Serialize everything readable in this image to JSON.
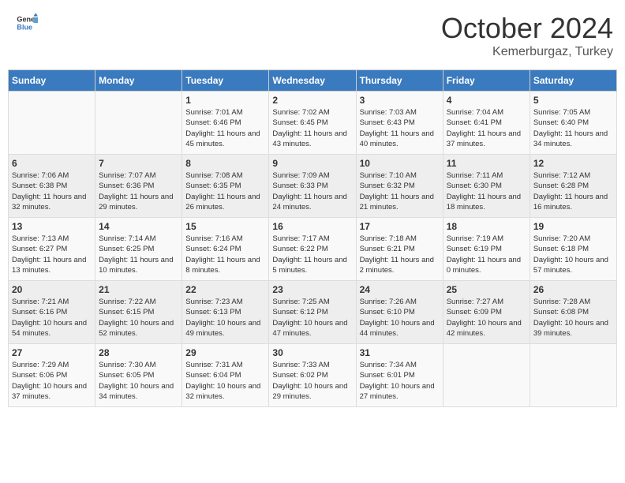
{
  "header": {
    "logo_general": "General",
    "logo_blue": "Blue",
    "month": "October 2024",
    "location": "Kemerburgaz, Turkey"
  },
  "days_of_week": [
    "Sunday",
    "Monday",
    "Tuesday",
    "Wednesday",
    "Thursday",
    "Friday",
    "Saturday"
  ],
  "weeks": [
    [
      {
        "day": "",
        "sunrise": "",
        "sunset": "",
        "daylight": ""
      },
      {
        "day": "",
        "sunrise": "",
        "sunset": "",
        "daylight": ""
      },
      {
        "day": "1",
        "sunrise": "Sunrise: 7:01 AM",
        "sunset": "Sunset: 6:46 PM",
        "daylight": "Daylight: 11 hours and 45 minutes."
      },
      {
        "day": "2",
        "sunrise": "Sunrise: 7:02 AM",
        "sunset": "Sunset: 6:45 PM",
        "daylight": "Daylight: 11 hours and 43 minutes."
      },
      {
        "day": "3",
        "sunrise": "Sunrise: 7:03 AM",
        "sunset": "Sunset: 6:43 PM",
        "daylight": "Daylight: 11 hours and 40 minutes."
      },
      {
        "day": "4",
        "sunrise": "Sunrise: 7:04 AM",
        "sunset": "Sunset: 6:41 PM",
        "daylight": "Daylight: 11 hours and 37 minutes."
      },
      {
        "day": "5",
        "sunrise": "Sunrise: 7:05 AM",
        "sunset": "Sunset: 6:40 PM",
        "daylight": "Daylight: 11 hours and 34 minutes."
      }
    ],
    [
      {
        "day": "6",
        "sunrise": "Sunrise: 7:06 AM",
        "sunset": "Sunset: 6:38 PM",
        "daylight": "Daylight: 11 hours and 32 minutes."
      },
      {
        "day": "7",
        "sunrise": "Sunrise: 7:07 AM",
        "sunset": "Sunset: 6:36 PM",
        "daylight": "Daylight: 11 hours and 29 minutes."
      },
      {
        "day": "8",
        "sunrise": "Sunrise: 7:08 AM",
        "sunset": "Sunset: 6:35 PM",
        "daylight": "Daylight: 11 hours and 26 minutes."
      },
      {
        "day": "9",
        "sunrise": "Sunrise: 7:09 AM",
        "sunset": "Sunset: 6:33 PM",
        "daylight": "Daylight: 11 hours and 24 minutes."
      },
      {
        "day": "10",
        "sunrise": "Sunrise: 7:10 AM",
        "sunset": "Sunset: 6:32 PM",
        "daylight": "Daylight: 11 hours and 21 minutes."
      },
      {
        "day": "11",
        "sunrise": "Sunrise: 7:11 AM",
        "sunset": "Sunset: 6:30 PM",
        "daylight": "Daylight: 11 hours and 18 minutes."
      },
      {
        "day": "12",
        "sunrise": "Sunrise: 7:12 AM",
        "sunset": "Sunset: 6:28 PM",
        "daylight": "Daylight: 11 hours and 16 minutes."
      }
    ],
    [
      {
        "day": "13",
        "sunrise": "Sunrise: 7:13 AM",
        "sunset": "Sunset: 6:27 PM",
        "daylight": "Daylight: 11 hours and 13 minutes."
      },
      {
        "day": "14",
        "sunrise": "Sunrise: 7:14 AM",
        "sunset": "Sunset: 6:25 PM",
        "daylight": "Daylight: 11 hours and 10 minutes."
      },
      {
        "day": "15",
        "sunrise": "Sunrise: 7:16 AM",
        "sunset": "Sunset: 6:24 PM",
        "daylight": "Daylight: 11 hours and 8 minutes."
      },
      {
        "day": "16",
        "sunrise": "Sunrise: 7:17 AM",
        "sunset": "Sunset: 6:22 PM",
        "daylight": "Daylight: 11 hours and 5 minutes."
      },
      {
        "day": "17",
        "sunrise": "Sunrise: 7:18 AM",
        "sunset": "Sunset: 6:21 PM",
        "daylight": "Daylight: 11 hours and 2 minutes."
      },
      {
        "day": "18",
        "sunrise": "Sunrise: 7:19 AM",
        "sunset": "Sunset: 6:19 PM",
        "daylight": "Daylight: 11 hours and 0 minutes."
      },
      {
        "day": "19",
        "sunrise": "Sunrise: 7:20 AM",
        "sunset": "Sunset: 6:18 PM",
        "daylight": "Daylight: 10 hours and 57 minutes."
      }
    ],
    [
      {
        "day": "20",
        "sunrise": "Sunrise: 7:21 AM",
        "sunset": "Sunset: 6:16 PM",
        "daylight": "Daylight: 10 hours and 54 minutes."
      },
      {
        "day": "21",
        "sunrise": "Sunrise: 7:22 AM",
        "sunset": "Sunset: 6:15 PM",
        "daylight": "Daylight: 10 hours and 52 minutes."
      },
      {
        "day": "22",
        "sunrise": "Sunrise: 7:23 AM",
        "sunset": "Sunset: 6:13 PM",
        "daylight": "Daylight: 10 hours and 49 minutes."
      },
      {
        "day": "23",
        "sunrise": "Sunrise: 7:25 AM",
        "sunset": "Sunset: 6:12 PM",
        "daylight": "Daylight: 10 hours and 47 minutes."
      },
      {
        "day": "24",
        "sunrise": "Sunrise: 7:26 AM",
        "sunset": "Sunset: 6:10 PM",
        "daylight": "Daylight: 10 hours and 44 minutes."
      },
      {
        "day": "25",
        "sunrise": "Sunrise: 7:27 AM",
        "sunset": "Sunset: 6:09 PM",
        "daylight": "Daylight: 10 hours and 42 minutes."
      },
      {
        "day": "26",
        "sunrise": "Sunrise: 7:28 AM",
        "sunset": "Sunset: 6:08 PM",
        "daylight": "Daylight: 10 hours and 39 minutes."
      }
    ],
    [
      {
        "day": "27",
        "sunrise": "Sunrise: 7:29 AM",
        "sunset": "Sunset: 6:06 PM",
        "daylight": "Daylight: 10 hours and 37 minutes."
      },
      {
        "day": "28",
        "sunrise": "Sunrise: 7:30 AM",
        "sunset": "Sunset: 6:05 PM",
        "daylight": "Daylight: 10 hours and 34 minutes."
      },
      {
        "day": "29",
        "sunrise": "Sunrise: 7:31 AM",
        "sunset": "Sunset: 6:04 PM",
        "daylight": "Daylight: 10 hours and 32 minutes."
      },
      {
        "day": "30",
        "sunrise": "Sunrise: 7:33 AM",
        "sunset": "Sunset: 6:02 PM",
        "daylight": "Daylight: 10 hours and 29 minutes."
      },
      {
        "day": "31",
        "sunrise": "Sunrise: 7:34 AM",
        "sunset": "Sunset: 6:01 PM",
        "daylight": "Daylight: 10 hours and 27 minutes."
      },
      {
        "day": "",
        "sunrise": "",
        "sunset": "",
        "daylight": ""
      },
      {
        "day": "",
        "sunrise": "",
        "sunset": "",
        "daylight": ""
      }
    ]
  ]
}
